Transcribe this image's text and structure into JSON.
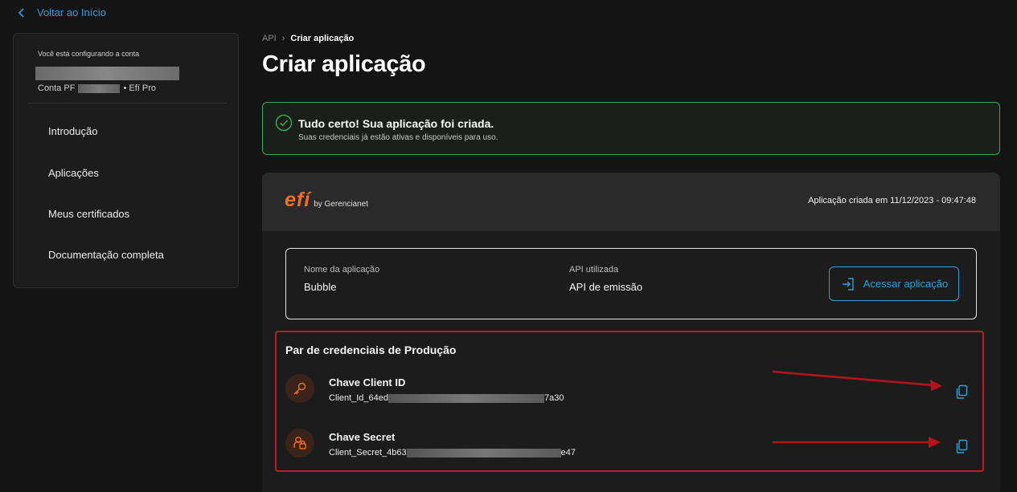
{
  "nav": {
    "back_label": "Voltar ao Início"
  },
  "sidebar": {
    "account_caption": "Você está configurando a conta",
    "account_type": "Conta PF",
    "account_plan": "• Efí Pro",
    "items": [
      {
        "label": "Introdução"
      },
      {
        "label": "Aplicações"
      },
      {
        "label": "Meus certificados"
      },
      {
        "label": "Documentação completa"
      }
    ]
  },
  "breadcrumb": {
    "root": "API",
    "current": "Criar aplicação"
  },
  "page": {
    "title": "Criar aplicação"
  },
  "alert": {
    "title": "Tudo certo! Sua aplicação foi criada.",
    "subtitle": "Suas credenciais já estão ativas e disponíveis para uso."
  },
  "card": {
    "logo_mark": "efí",
    "logo_by": "by Gerencianet",
    "created_at": "Aplicação criada em 11/12/2023 - 09:47:48",
    "app_name_label": "Nome da aplicação",
    "app_name_value": "Bubble",
    "api_label": "API utilizada",
    "api_value": "API de emissão",
    "access_button": "Acessar aplicação"
  },
  "credentials": {
    "title": "Par de credenciais de Produção",
    "client_id": {
      "label": "Chave Client ID",
      "prefix": "Client_Id_64ed",
      "suffix": "7a30"
    },
    "client_secret": {
      "label": "Chave Secret",
      "prefix": "Client_Secret_4b63",
      "suffix": "e47"
    }
  },
  "colors": {
    "accent_blue": "#2f9fd6",
    "brand_orange": "#f37021",
    "success_green": "#33a853",
    "annotation_red": "#c2181f"
  }
}
